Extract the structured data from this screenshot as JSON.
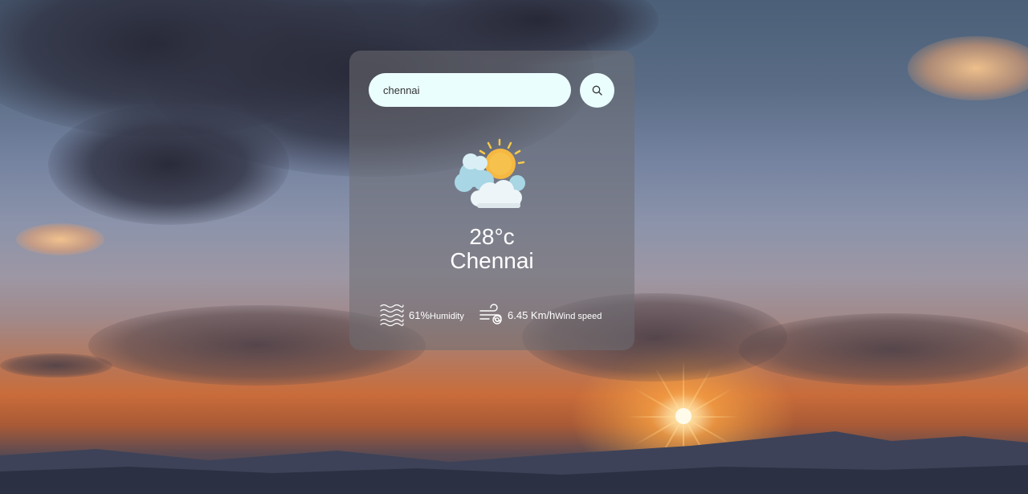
{
  "search": {
    "value": "chennai",
    "button_icon": "search-icon"
  },
  "weather": {
    "icon": "partly-cloudy-sun-icon",
    "temperature": "28°c",
    "city": "Chennai"
  },
  "stats": {
    "humidity": {
      "icon": "humidity-waves-icon",
      "value": "61%",
      "label": "Humidity"
    },
    "wind": {
      "icon": "wind-icon",
      "value": "6.45 Km/h",
      "label": "Wind speed"
    }
  },
  "colors": {
    "input_background": "#ebfefe",
    "card_background": "rgba(110,110,115,0.55)",
    "text": "#ffffff",
    "sun": "#f5b941"
  }
}
